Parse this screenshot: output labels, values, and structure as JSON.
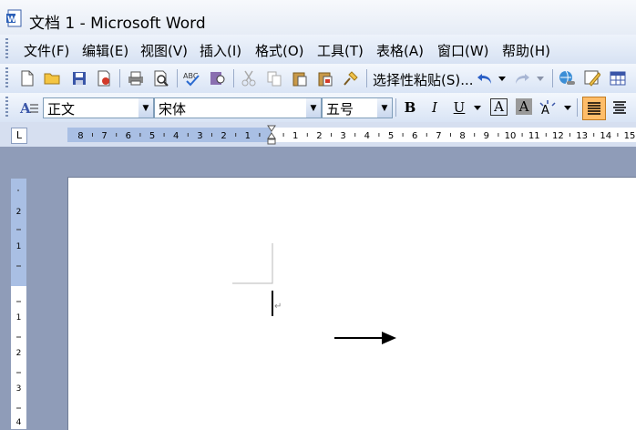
{
  "window": {
    "title": "文档 1 - Microsoft Word",
    "app_icon": "word-doc-icon"
  },
  "menubar": {
    "items": [
      "文件(F)",
      "编辑(E)",
      "视图(V)",
      "插入(I)",
      "格式(O)",
      "工具(T)",
      "表格(A)",
      "窗口(W)",
      "帮助(H)"
    ]
  },
  "toolbar": {
    "paste_special_label": "选择性粘贴(S)...",
    "icons": [
      "new-icon",
      "open-icon",
      "save-icon",
      "permission-icon",
      "print-icon",
      "print-preview-icon",
      "spelling-icon",
      "research-icon",
      "cut-icon",
      "copy-icon",
      "paste-icon",
      "format-painter-icon",
      "undo-icon",
      "redo-icon",
      "hyperlink-icon",
      "tables-borders-icon",
      "insert-table-icon"
    ]
  },
  "format_toolbar": {
    "style_value": "正文",
    "font_value": "宋体",
    "size_value": "五号",
    "bold": "B",
    "italic": "I",
    "underline": "U",
    "char_border": "A",
    "char_shading": "A"
  },
  "ruler": {
    "corner_symbol": "L",
    "left_numbers": [
      "8",
      "7",
      "6",
      "5",
      "4",
      "3",
      "2",
      "1"
    ],
    "right_numbers": [
      "1",
      "2",
      "3",
      "4",
      "5",
      "6",
      "7",
      "8",
      "9",
      "10",
      "11",
      "12",
      "13",
      "14",
      "15"
    ],
    "vertical_numbers": [
      "2",
      "1",
      "1",
      "2",
      "3",
      "4"
    ]
  },
  "document": {
    "paragraph_mark": "↵"
  },
  "colors": {
    "title_bg": "#e6ecf6",
    "toolbar_bg": "#d9e4f5",
    "workspace": "#8f9cb8",
    "ruler_shade": "#a9bfe4",
    "active_button": "#ffbd69"
  }
}
